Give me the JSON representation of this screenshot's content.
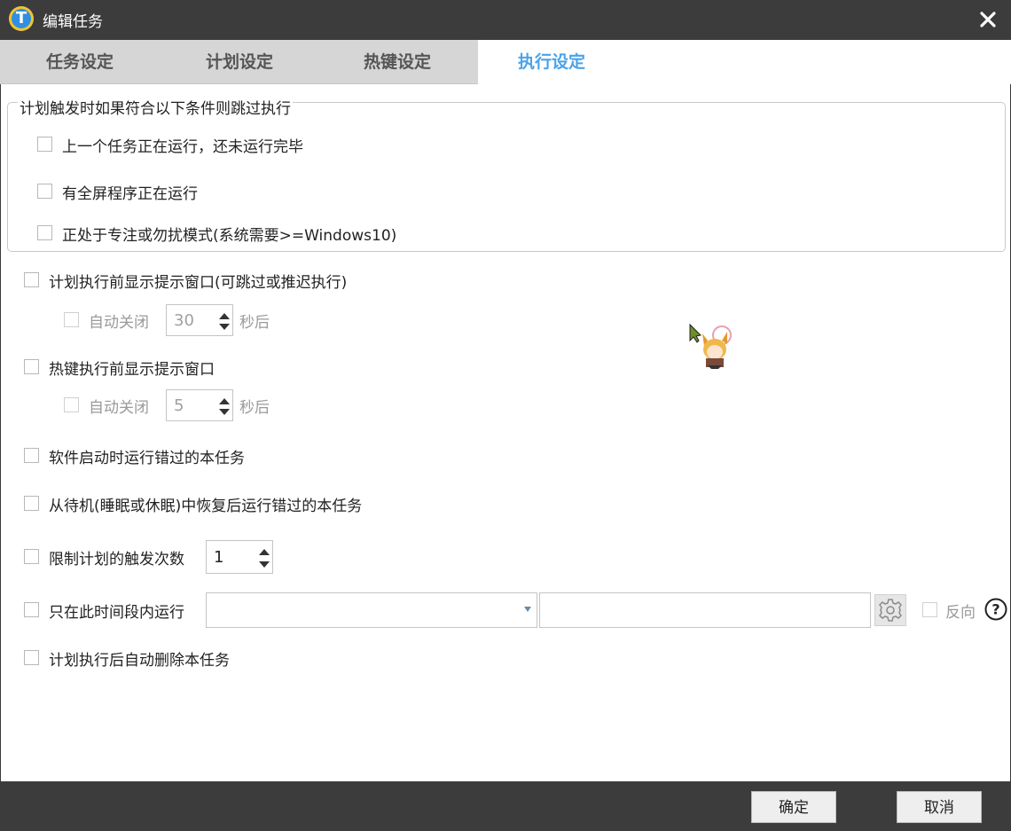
{
  "window": {
    "title": "编辑任务"
  },
  "tabs": [
    "任务设定",
    "计划设定",
    "热键设定",
    "执行设定"
  ],
  "active_tab": "执行设定",
  "skip_group": {
    "title": "计划触发时如果符合以下条件则跳过执行",
    "items": [
      {
        "label": "上一个任务正在运行，还未运行完毕",
        "checked": false
      },
      {
        "label": "有全屏程序正在运行",
        "checked": false
      },
      {
        "label": "正处于专注或勿扰模式(系统需要>=Windows10)",
        "checked": false
      }
    ]
  },
  "options": {
    "plan_prompt": {
      "label": "计划执行前显示提示窗口(可跳过或推迟执行)",
      "checked": false
    },
    "plan_auto_close": {
      "label": "自动关闭",
      "value": "30",
      "suffix": "秒后",
      "enabled": false
    },
    "hotkey_prompt": {
      "label": "热键执行前显示提示窗口",
      "checked": false
    },
    "hotkey_auto_close": {
      "label": "自动关闭",
      "value": "5",
      "suffix": "秒后",
      "enabled": false
    },
    "run_missed_on_start": {
      "label": "软件启动时运行错过的本任务",
      "checked": false
    },
    "run_missed_on_resume": {
      "label": "从待机(睡眠或休眠)中恢复后运行错过的本任务",
      "checked": false
    },
    "limit_triggers": {
      "label": "限制计划的触发次数",
      "checked": false,
      "value": "1"
    },
    "time_range": {
      "label": "只在此时间段内运行",
      "checked": false,
      "select_value": "",
      "text_value": "",
      "reverse_label": "反向"
    },
    "auto_delete": {
      "label": "计划执行后自动删除本任务",
      "checked": false
    }
  },
  "footer": {
    "ok_label": "确定",
    "cancel_label": "取消"
  },
  "colors": {
    "titlebar": "#3c3c3c",
    "active_tab_text": "#4aa3ea",
    "tabbar": "#d6d6d6"
  },
  "icons": [
    "app-logo-icon",
    "close-icon",
    "gear-icon",
    "help-icon"
  ]
}
